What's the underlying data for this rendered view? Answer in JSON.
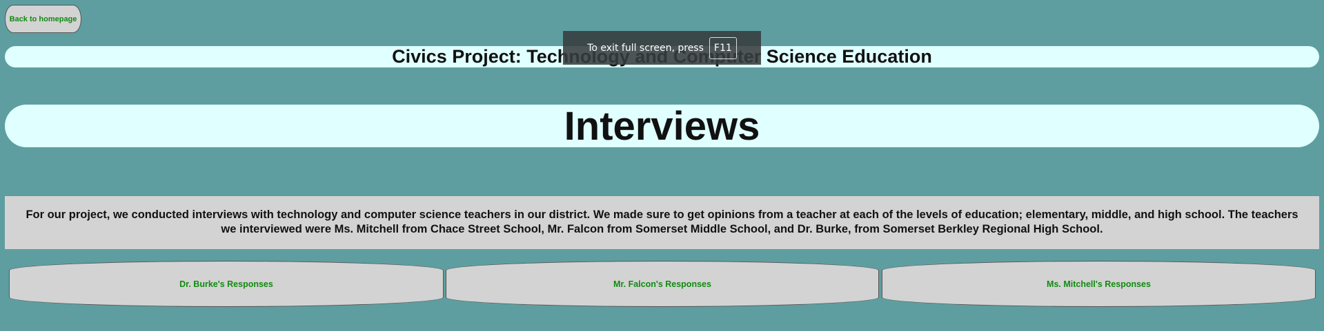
{
  "nav": {
    "home_label": "Back to homepage"
  },
  "header": {
    "title": "Civics Project: Technology and Computer Science Education"
  },
  "main": {
    "heading": "Interviews",
    "intro": "For our project, we conducted interviews with technology and computer science teachers in our district. We made sure to get opinions from a teacher at each of the levels of education; elementary, middle, and high school. The teachers we interviewed were Ms. Mitchell from Chace Street School, Mr. Falcon from Somerset Middle School, and Dr. Burke, from Somerset Berkley Regional High School.",
    "responses": [
      {
        "label": "Dr. Burke's Responses"
      },
      {
        "label": "Mr. Falcon's Responses"
      },
      {
        "label": "Ms. Mitchell's Responses"
      }
    ]
  },
  "fullscreen_notice": {
    "text": "To exit full screen, press",
    "key": "F11"
  },
  "colors": {
    "background": "#5f9ea0",
    "panel": "#e0ffff",
    "button": "#d3d3d3",
    "link_text": "#118a11"
  }
}
